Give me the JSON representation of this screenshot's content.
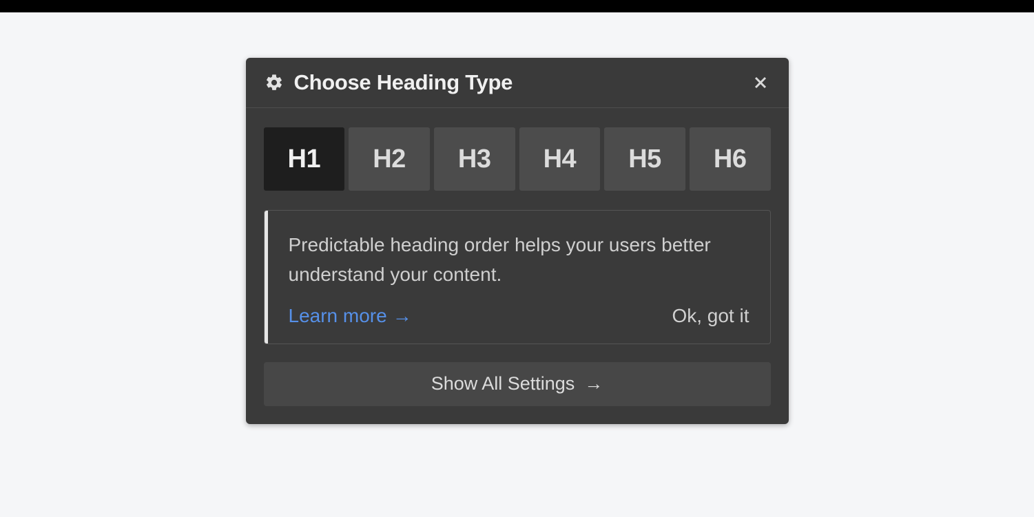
{
  "panel": {
    "title": "Choose Heading Type",
    "headings": {
      "options": [
        {
          "label": "H1",
          "selected": true
        },
        {
          "label": "H2",
          "selected": false
        },
        {
          "label": "H3",
          "selected": false
        },
        {
          "label": "H4",
          "selected": false
        },
        {
          "label": "H5",
          "selected": false
        },
        {
          "label": "H6",
          "selected": false
        }
      ]
    },
    "info": {
      "text": "Predictable heading order helps your users better understand your content.",
      "learn_more_label": "Learn more",
      "ok_label": "Ok, got it"
    },
    "show_all_label": "Show All Settings",
    "colors": {
      "panel_bg": "#3a3a3a",
      "tab_bg": "#4c4c4c",
      "tab_selected_bg": "#1e1e1e",
      "link": "#5690e8",
      "text": "#cfcfcf"
    }
  }
}
